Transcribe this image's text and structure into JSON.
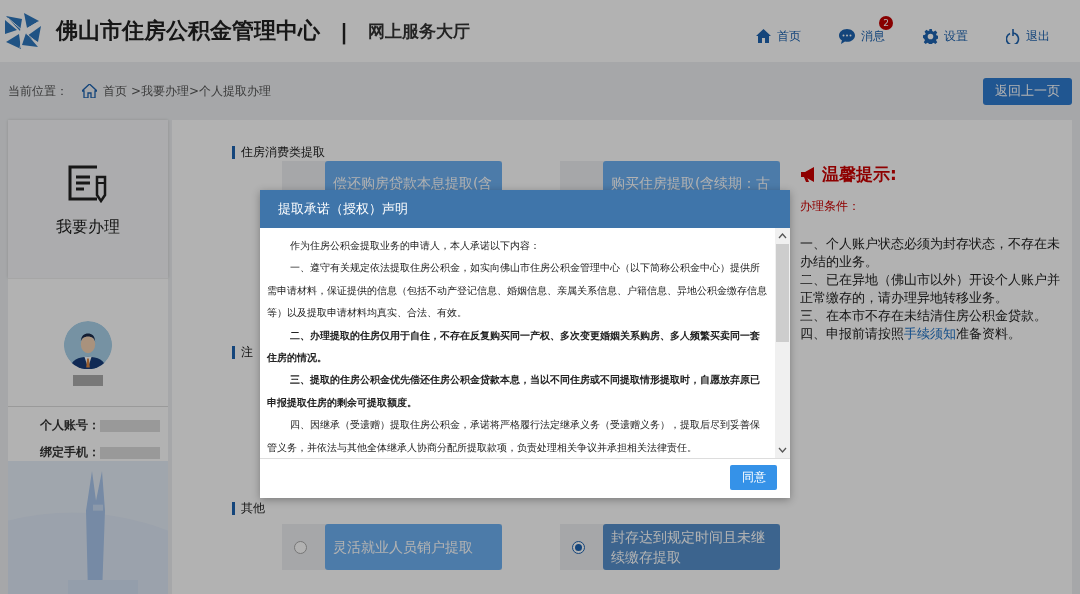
{
  "header": {
    "title": "佛山市住房公积金管理中心",
    "separator": "|",
    "subtitle": "网上服务大厅",
    "nav": [
      {
        "kind": "home",
        "label": "首页"
      },
      {
        "kind": "message",
        "label": "消息",
        "badge": "2"
      },
      {
        "kind": "settings",
        "label": "设置"
      },
      {
        "kind": "logout",
        "label": "退出"
      }
    ]
  },
  "breadcrumb": {
    "label": "当前位置：",
    "home": "首页",
    "path": ">我要办理>个人提取办理"
  },
  "back_button": "返回上一页",
  "sidebar": {
    "menu_card": "我要办理",
    "user_fields": [
      {
        "label": "个人账号："
      },
      {
        "label": "绑定手机："
      }
    ]
  },
  "sections": [
    {
      "title": "住房消费类提取",
      "options": [
        {
          "label": "偿还购房贷款本息提取(含"
        },
        {
          "label": "购买住房提取(含续期：古"
        }
      ]
    },
    {
      "title": "注"
    },
    {
      "title": "其他",
      "options": [
        {
          "label": "灵活就业人员销户提取",
          "selected": false
        },
        {
          "label": "封存达到规定时间且未继续缴存提取",
          "selected": true
        }
      ]
    }
  ],
  "tips": {
    "title": "温馨提示:",
    "subtitle": "办理条件：",
    "lines": [
      {
        "text": "一、个人账户状态必须为封存状态，不存在未办结的业务。"
      },
      {
        "text": "二、已在异地（佛山市以外）开设个人账户并正常缴存的，请办理异地转移业务。"
      },
      {
        "text": "三、在本市不存在未结清住房公积金贷款。"
      },
      {
        "text": "四、申报前请按照",
        "link": "手续须知",
        "after": "准备资料。"
      }
    ]
  },
  "modal": {
    "title": "提取承诺（授权）声明",
    "paragraphs": [
      {
        "text": "作为住房公积金提取业务的申请人，本人承诺以下内容：",
        "bold": false
      },
      {
        "text": "一、遵守有关规定依法提取住房公积金，如实向佛山市住房公积金管理中心（以下简称公积金中心）提供所需申请材料，保证提供的信息（包括不动产登记信息、婚姻信息、亲属关系信息、户籍信息、异地公积金缴存信息等）以及提取申请材料均真实、合法、有效。",
        "bold": false
      },
      {
        "text": "二、办理提取的住房仅用于自住，不存在反复购买同一产权、多次变更婚姻关系购房、多人频繁买卖同一套住房的情况。",
        "bold": true
      },
      {
        "text": "三、提取的住房公积金优先偿还住房公积金贷款本息，当以不同住房或不同提取情形提取时，自愿放弃原已申报提取住房的剩余可提取额度。",
        "bold": true
      },
      {
        "text": "四、因继承（受遗赠）提取住房公积金，承诺将严格履行法定继承义务（受遗赠义务），提取后尽到妥善保管义务，并依法与其他全体继承人协商分配所提取款项，负责处理相关争议并承担相关法律责任。",
        "bold": false
      }
    ],
    "button": "同意"
  }
}
